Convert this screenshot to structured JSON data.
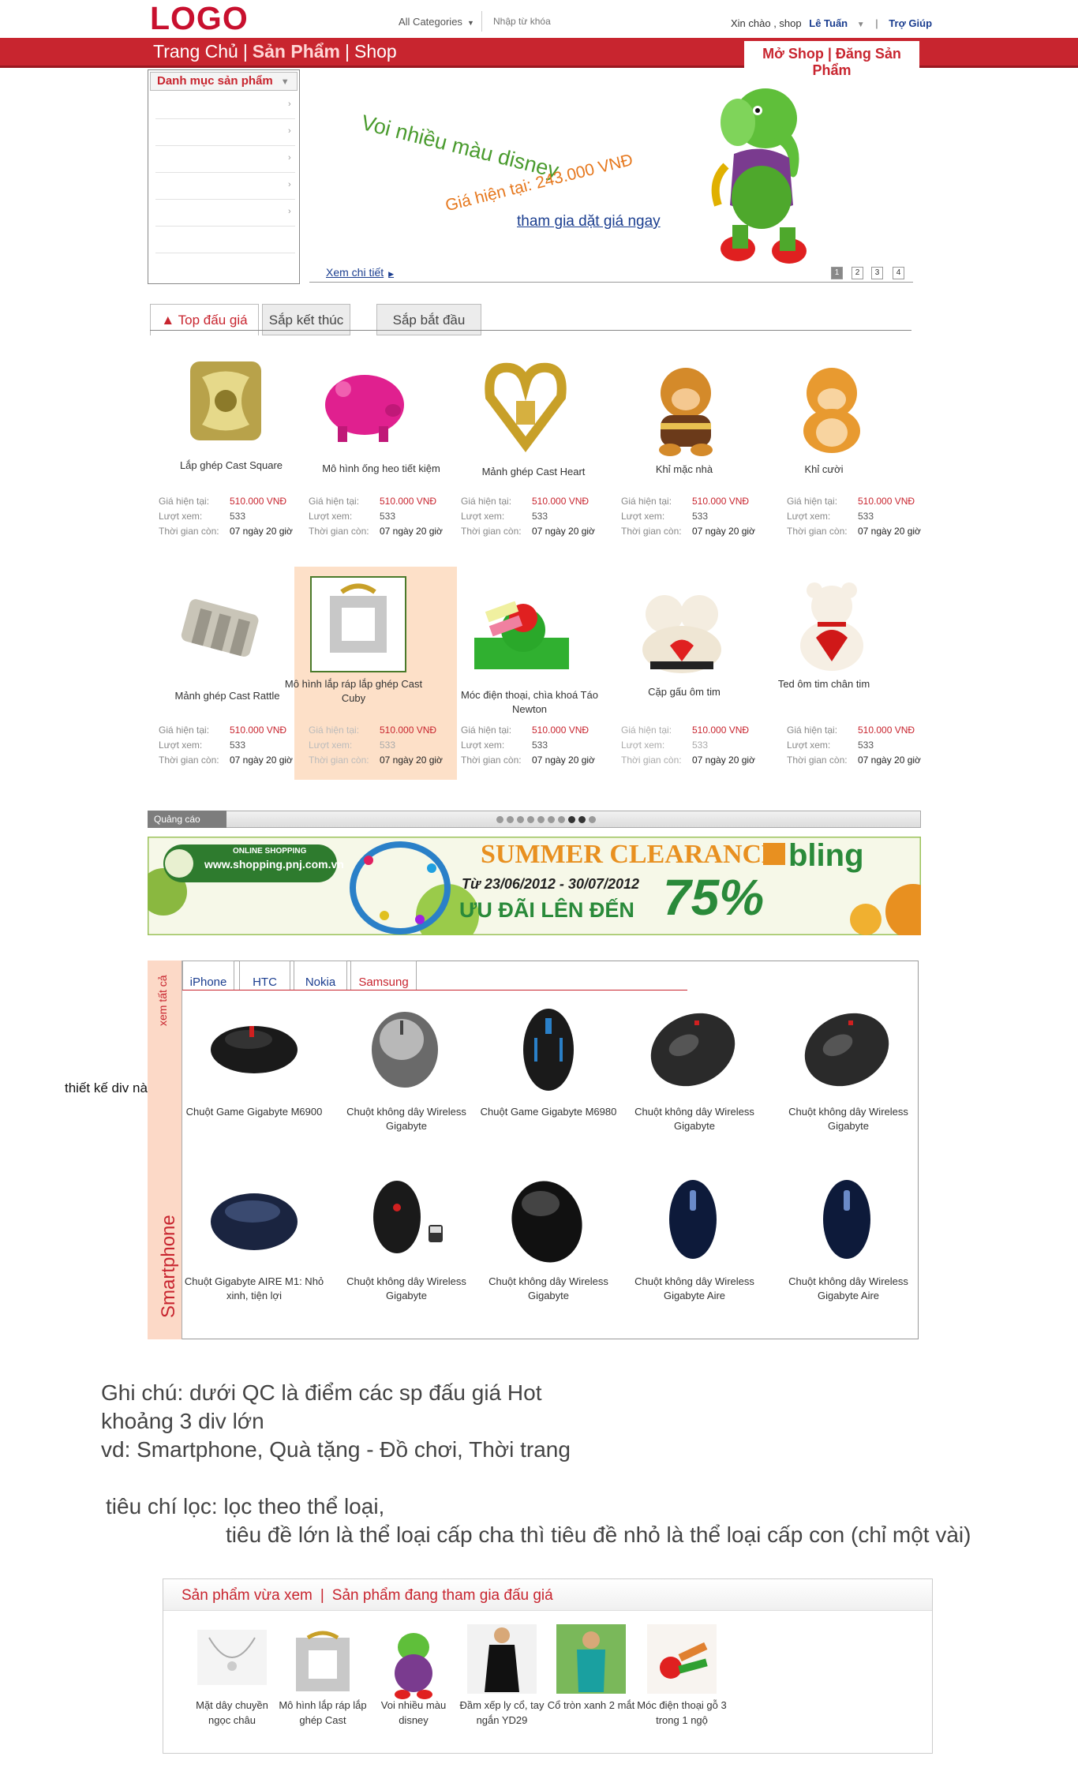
{
  "header": {
    "logo": "LOGO",
    "category_select": "All Categories",
    "search_placeholder": "Nhập từ khóa",
    "greeting": "Xin chào , shop",
    "user": "Lê Tuấn",
    "help": "Trợ Giúp"
  },
  "nav": {
    "home": "Trang Chủ",
    "products": "Sản Phẩm",
    "shop": "Shop",
    "right": "Mở Shop | Đăng Sản Phẩm"
  },
  "category_menu": {
    "title": "Danh mục sản phẩm"
  },
  "hero": {
    "line1": "Voi nhiều màu disney",
    "line2": "Giá hiện tại: 243.000 VNĐ",
    "cta": "tham gia dặt giá ngay",
    "more": "Xem chi tiết",
    "pages": [
      "1",
      "2",
      "3",
      "4"
    ],
    "active_page": "1"
  },
  "tabs": [
    "Top đấu giá",
    "Sắp kết thúc",
    "Sắp bắt đầu"
  ],
  "labels": {
    "price": "Giá hiện tại:",
    "views": "Lượt xem:",
    "time": "Thời gian còn:"
  },
  "products_row1": [
    {
      "name": "Lắp ghép Cast Square",
      "price": "510.000 VNĐ",
      "views": "533",
      "time": "07 ngày 20 giờ"
    },
    {
      "name": "Mô hình ống heo tiết kiệm",
      "price": "510.000 VNĐ",
      "views": "533",
      "time": "07 ngày 20 giờ"
    },
    {
      "name": "Mảnh ghép Cast Heart",
      "price": "510.000 VNĐ",
      "views": "533",
      "time": "07 ngày 20 giờ"
    },
    {
      "name": "Khỉ mặc nhà",
      "price": "510.000 VNĐ",
      "views": "533",
      "time": "07 ngày 20 giờ"
    },
    {
      "name": "Khỉ cười",
      "price": "510.000 VNĐ",
      "views": "533",
      "time": "07 ngày 20 giờ"
    }
  ],
  "products_row2": [
    {
      "name": "Mảnh ghép Cast Rattle",
      "price": "510.000 VNĐ",
      "views": "533",
      "time": "07 ngày 20 giờ"
    },
    {
      "name": "Mô hình lắp ráp lắp ghép Cast Cuby",
      "price": "510.000 VNĐ",
      "views": "533",
      "time": "07 ngày 20 giờ"
    },
    {
      "name": "Móc điện thoại, chìa khoá Táo Newton",
      "price": "510.000 VNĐ",
      "views": "533",
      "time": "07 ngày 20 giờ"
    },
    {
      "name": "Cặp gấu ôm tim",
      "price": "510.000 VNĐ",
      "views": "533",
      "time": "07 ngày 20 giờ"
    },
    {
      "name": "Ted ôm tim chân tim",
      "price": "510.000 VNĐ",
      "views": "533",
      "time": "07 ngày 20 giờ"
    }
  ],
  "ad": {
    "label": "Quảng cáo",
    "banner_site": "www.shopping.pnj.com.vn",
    "banner_online": "ONLINE SHOPPING",
    "banner_title": "SUMMER CLEARANCE",
    "banner_dates": "Từ 23/06/2012 - 30/07/2012",
    "banner_offer": "ƯU ĐÃI LÊN ĐẾN",
    "banner_pct": "75%",
    "banner_brand": "bling"
  },
  "category_box": {
    "side_all": "xem tất cả",
    "side_title": "Smartphone",
    "tabs": [
      "iPhone",
      "HTC",
      "Nokia",
      "Samsung"
    ],
    "items_row1": [
      {
        "name": "Chuột Game Gigabyte M6900"
      },
      {
        "name": "Chuột không dây Wireless Gigabyte"
      },
      {
        "name": "Chuột Game Gigabyte M6980"
      },
      {
        "name": "Chuột không dây Wireless Gigabyte"
      },
      {
        "name": "Chuột không dây Wireless Gigabyte"
      }
    ],
    "items_row2": [
      {
        "name": "Chuột Gigabyte AIRE M1: Nhỏ xinh, tiện lợi"
      },
      {
        "name": "Chuột không dây Wireless Gigabyte"
      },
      {
        "name": "Chuột không dây Wireless Gigabyte"
      },
      {
        "name": "Chuột không dây Wireless Gigabyte Aire"
      },
      {
        "name": "Chuột không dây Wireless Gigabyte Aire"
      }
    ]
  },
  "annotation": "thiết kế div này",
  "notes": {
    "l1": "Ghi chú: dưới QC là điểm các sp đấu giá Hot",
    "l2": "khoảng 3 div lớn",
    "l3": "vd: Smartphone, Quà tặng - Đồ chơi, Thời trang",
    "l4": "tiêu chí lọc:  lọc theo thể loại,",
    "l5": "tiêu đề lớn là thể loại cấp cha thì tiêu đề  nhỏ là thể loại cấp con (chỉ một vài)"
  },
  "recent": {
    "tab1": "Sản phẩm vừa xem",
    "tab2": "Sản phẩm đang tham gia đấu giá",
    "items": [
      {
        "name": "Mặt dây chuyền ngọc châu"
      },
      {
        "name": "Mô hình lắp ráp lắp ghép Cast"
      },
      {
        "name": "Voi nhiều màu disney"
      },
      {
        "name": "Đầm xếp ly cổ, tay ngắn YD29"
      },
      {
        "name": "Cổ tròn xanh 2 mắt"
      },
      {
        "name": "Móc điện thoại gỗ 3 trong 1 ngộ"
      }
    ]
  },
  "colors": {
    "brand_red": "#c8252f",
    "link_blue": "#1a3d8f",
    "highlight": "#fde0c8"
  }
}
